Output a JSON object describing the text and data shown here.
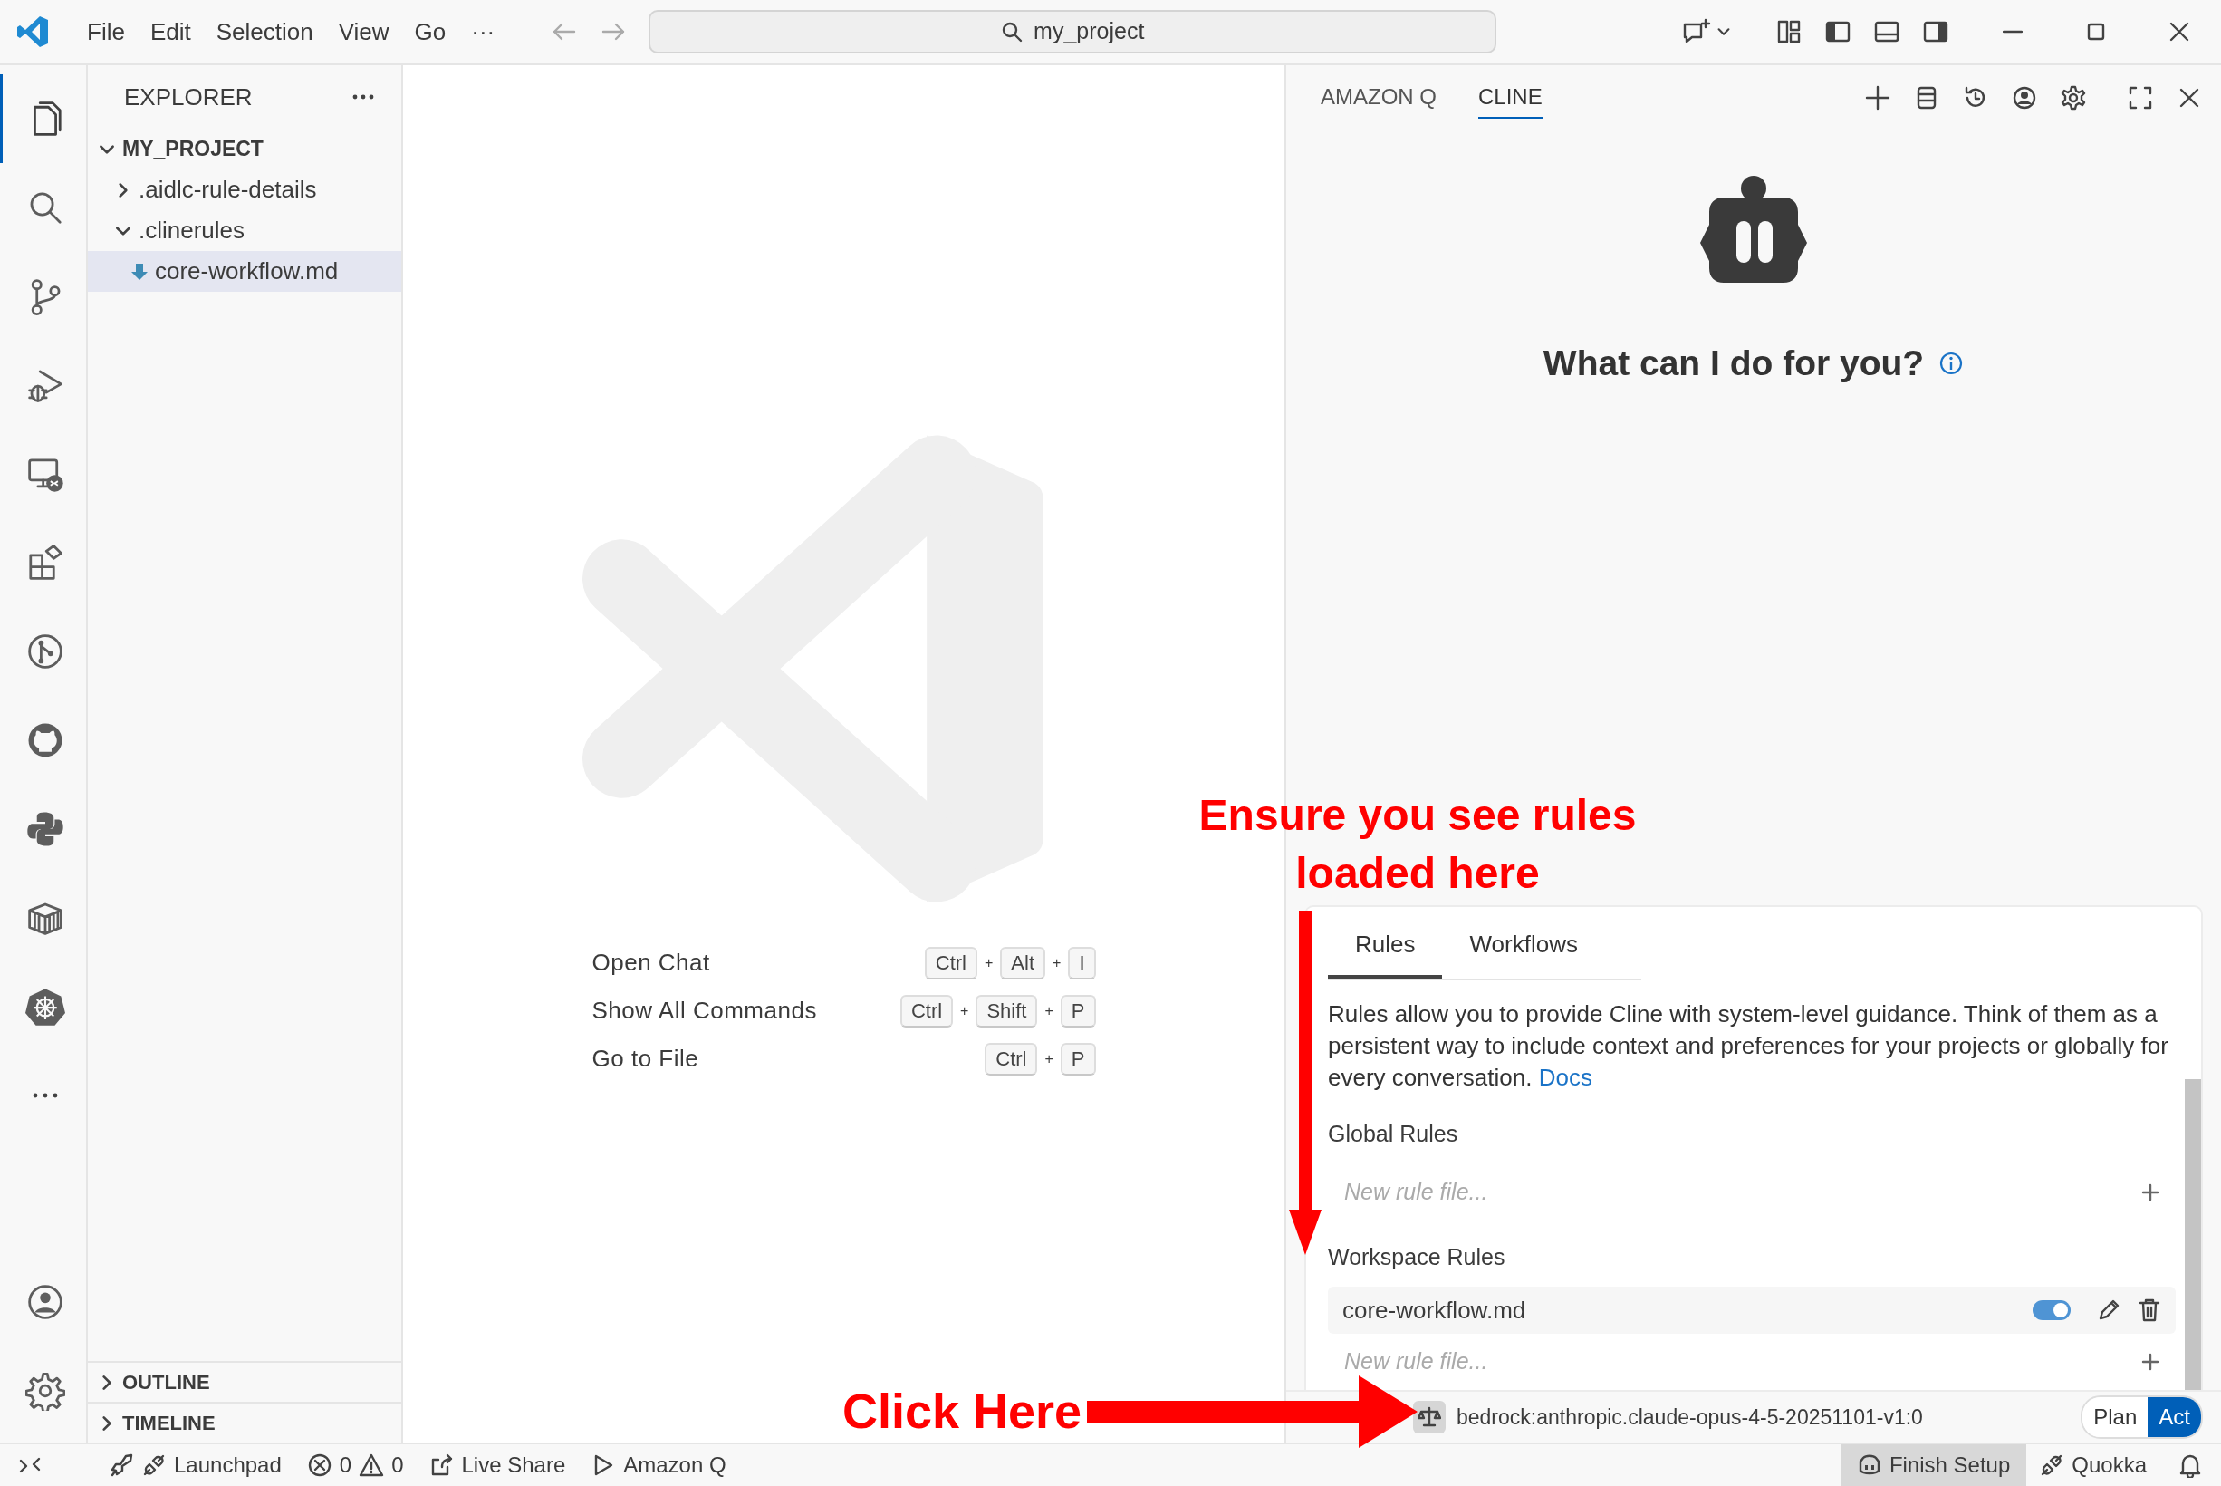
{
  "title_bar": {
    "menu": [
      "File",
      "Edit",
      "Selection",
      "View",
      "Go",
      "···"
    ],
    "search": "my_project"
  },
  "activity_bar": [
    {
      "kind": "files",
      "selected": true
    },
    {
      "kind": "search",
      "selected": false
    },
    {
      "kind": "source-control",
      "selected": false
    },
    {
      "kind": "run-debug",
      "selected": false
    },
    {
      "kind": "remote",
      "selected": false
    },
    {
      "kind": "extensions",
      "selected": false
    },
    {
      "kind": "git-graph",
      "selected": false
    },
    {
      "kind": "github",
      "selected": false
    },
    {
      "kind": "python",
      "selected": false
    },
    {
      "kind": "containers",
      "selected": false
    },
    {
      "kind": "kubernetes",
      "selected": false
    },
    {
      "kind": "more",
      "selected": false
    }
  ],
  "activity_bar_bottom": [
    {
      "kind": "account"
    },
    {
      "kind": "settings"
    }
  ],
  "explorer": {
    "title": "EXPLORER",
    "tree": [
      {
        "label": "MY_PROJECT",
        "expanded": true,
        "children": [
          {
            "label": ".aidlc-rule-details",
            "expanded": false,
            "selected": false
          },
          {
            "label": ".clinerules",
            "expanded": true,
            "selected": false,
            "children": [
              {
                "label": "core-workflow.md",
                "selected": true
              }
            ]
          }
        ]
      }
    ],
    "sections": [
      {
        "label": "OUTLINE",
        "expanded": false
      },
      {
        "label": "TIMELINE",
        "expanded": false
      }
    ]
  },
  "editor": {
    "shortcuts": [
      {
        "label": "Open Chat",
        "keys": [
          "Ctrl",
          "Alt",
          "I"
        ]
      },
      {
        "label": "Show All Commands",
        "keys": [
          "Ctrl",
          "Shift",
          "P"
        ]
      },
      {
        "label": "Go to File",
        "keys": [
          "Ctrl",
          "P"
        ]
      }
    ],
    "separator": "+"
  },
  "panel": {
    "tabs": [
      {
        "label": "AMAZON Q",
        "selected": false
      },
      {
        "label": "CLINE",
        "selected": true
      }
    ],
    "greeting": "What can I do for you?",
    "rules": {
      "tabs": [
        {
          "label": "Rules",
          "selected": true
        },
        {
          "label": "Workflows",
          "selected": false
        }
      ],
      "description": "Rules allow you to provide Cline with system-level guidance. Think of them as a persistent way to include context and preferences for your projects or globally for every conversation.",
      "docs_link": "Docs",
      "groups": [
        {
          "heading": "Global Rules",
          "placeholder": "New rule file..."
        },
        {
          "heading": "Workspace Rules",
          "files": [
            {
              "name": "core-workflow.md",
              "on": true
            }
          ],
          "placeholder": "New rule file..."
        }
      ]
    },
    "model": "bedrock:anthropic.claude-opus-4-5-20251101-v1:0",
    "modes": [
      {
        "label": "Plan",
        "selected": false
      },
      {
        "label": "Act",
        "selected": true
      }
    ]
  },
  "status_bar": {
    "launchpad": "Launchpad",
    "errors": "0",
    "warnings": "0",
    "live_share": "Live Share",
    "amazon_q": "Amazon Q",
    "finish_setup": "Finish Setup",
    "quokka": "Quokka"
  },
  "annotations": [
    {
      "kind": "rules-callout",
      "text": "Ensure you see rules loaded here"
    },
    {
      "kind": "click-callout",
      "text": "Click Here"
    }
  ]
}
